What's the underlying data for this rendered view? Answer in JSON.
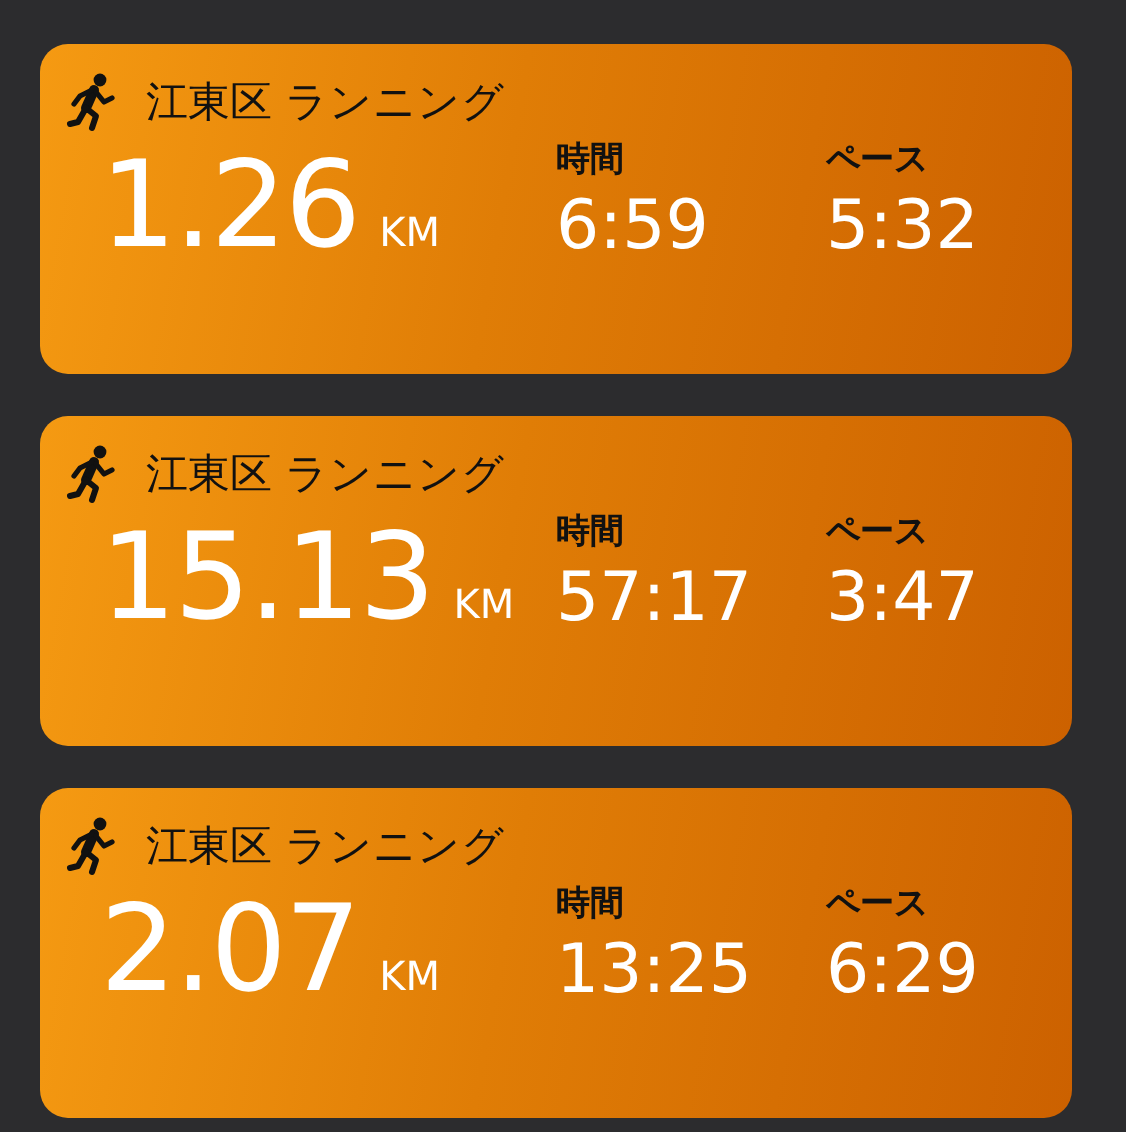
{
  "workouts": [
    {
      "title": "江東区 ランニング",
      "distance": "1.26",
      "unit": "KM",
      "time_label": "時間",
      "time": "6:59",
      "pace_label": "ペース",
      "pace": "5:32"
    },
    {
      "title": "江東区 ランニング",
      "distance": "15.13",
      "unit": "KM",
      "time_label": "時間",
      "time": "57:17",
      "pace_label": "ペース",
      "pace": "3:47"
    },
    {
      "title": "江東区 ランニング",
      "distance": "2.07",
      "unit": "KM",
      "time_label": "時間",
      "time": "13:25",
      "pace_label": "ペース",
      "pace": "6:29"
    }
  ]
}
